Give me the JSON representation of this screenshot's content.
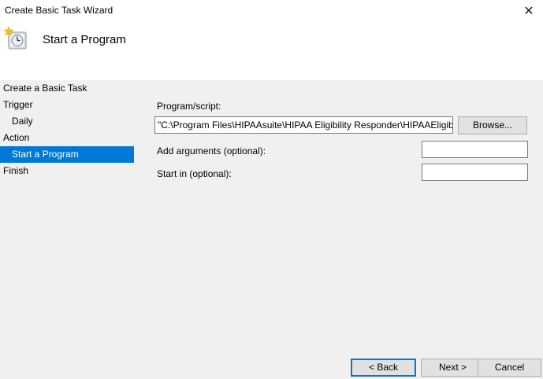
{
  "window": {
    "title": "Create Basic Task Wizard",
    "close_glyph": "✕"
  },
  "header": {
    "title": "Start a Program",
    "icon": "task-clock-icon"
  },
  "sidebar": {
    "items": [
      {
        "label": "Create a Basic Task"
      },
      {
        "label": "Trigger"
      },
      {
        "label": "Daily"
      },
      {
        "label": "Action"
      },
      {
        "label": "Start a Program"
      },
      {
        "label": "Finish"
      }
    ]
  },
  "form": {
    "program_label": "Program/script:",
    "program_value": "\"C:\\Program Files\\HIPAAsuite\\HIPAA Eligibility Responder\\HIPAAEligibility",
    "browse_label": "Browse...",
    "args_label": "Add arguments (optional):",
    "args_value": "",
    "startin_label": "Start in (optional):",
    "startin_value": ""
  },
  "footer": {
    "back_label": "< Back",
    "next_label": "Next >",
    "cancel_label": "Cancel"
  }
}
